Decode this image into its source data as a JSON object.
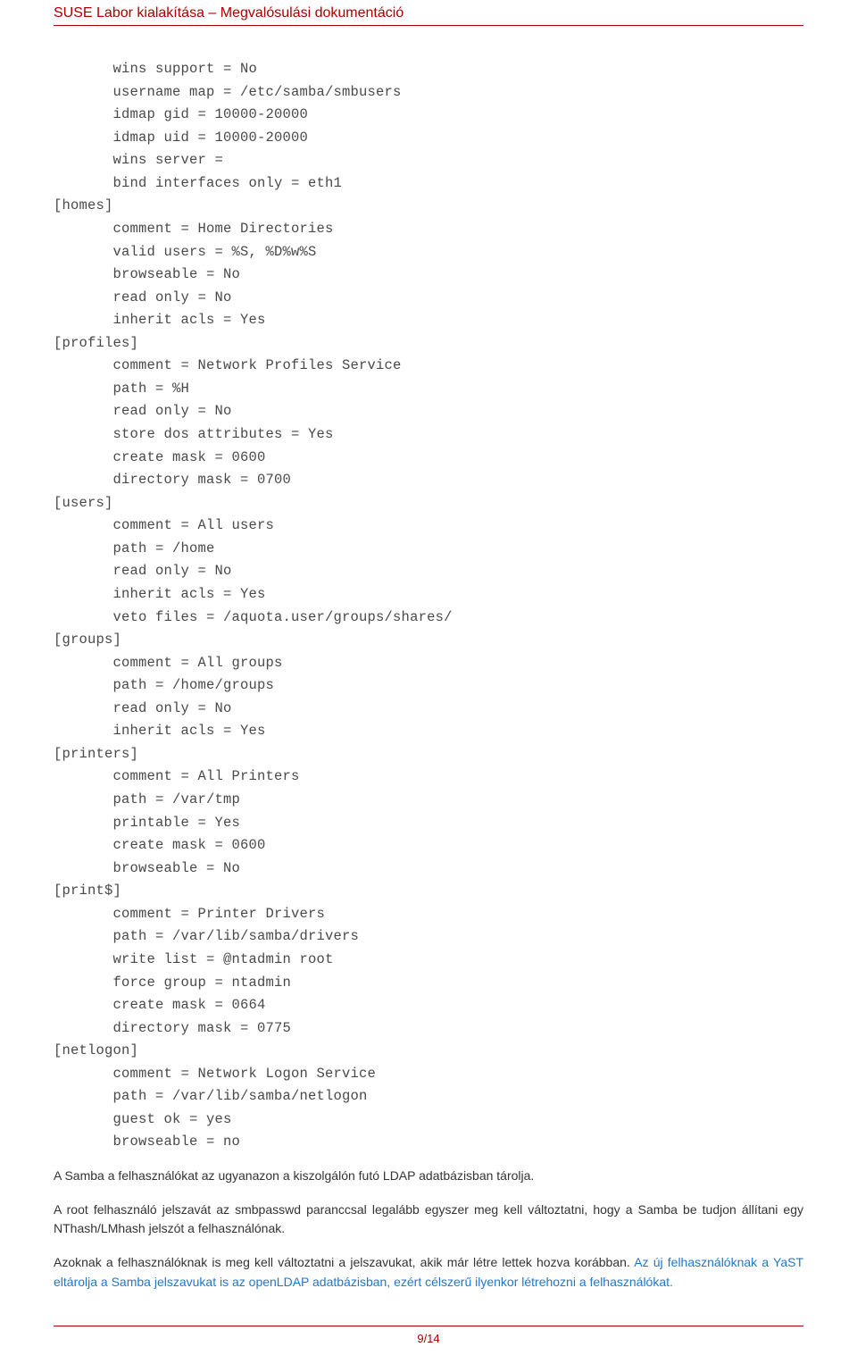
{
  "header": {
    "title": "SUSE Labor kialakítása – Megvalósulási dokumentáció"
  },
  "code": "       wins support = No\n       username map = /etc/samba/smbusers\n       idmap gid = 10000-20000\n       idmap uid = 10000-20000\n       wins server =\n       bind interfaces only = eth1\n[homes]\n       comment = Home Directories\n       valid users = %S, %D%w%S\n       browseable = No\n       read only = No\n       inherit acls = Yes\n[profiles]\n       comment = Network Profiles Service\n       path = %H\n       read only = No\n       store dos attributes = Yes\n       create mask = 0600\n       directory mask = 0700\n[users]\n       comment = All users\n       path = /home\n       read only = No\n       inherit acls = Yes\n       veto files = /aquota.user/groups/shares/\n[groups]\n       comment = All groups\n       path = /home/groups\n       read only = No\n       inherit acls = Yes\n[printers]\n       comment = All Printers\n       path = /var/tmp\n       printable = Yes\n       create mask = 0600\n       browseable = No\n[print$]\n       comment = Printer Drivers\n       path = /var/lib/samba/drivers\n       write list = @ntadmin root\n       force group = ntadmin\n       create mask = 0664\n       directory mask = 0775\n[netlogon]\n       comment = Network Logon Service\n       path = /var/lib/samba/netlogon\n       guest ok = yes\n       browseable = no",
  "paragraphs": {
    "p1": "A Samba a felhasználókat az ugyanazon a kiszolgálón futó LDAP adatbázisban tárolja.",
    "p2": "A root felhasználó jelszavát az smbpasswd paranccsal legalább egyszer meg kell változtatni, hogy a Samba be tudjon állítani egy NThash/LMhash jelszót a felhasználónak.",
    "p3a": "Azoknak a felhasználóknak is meg kell változtatni a jelszavukat, akik már létre lettek hozva korábban.",
    "p3b": " Az új felhasználóknak a YaST eltárolja a Samba jelszavukat is az openLDAP adatbázisban, ezért célszerű ilyenkor létrehozni a felhasználókat."
  },
  "footer": {
    "page": "9/14"
  }
}
